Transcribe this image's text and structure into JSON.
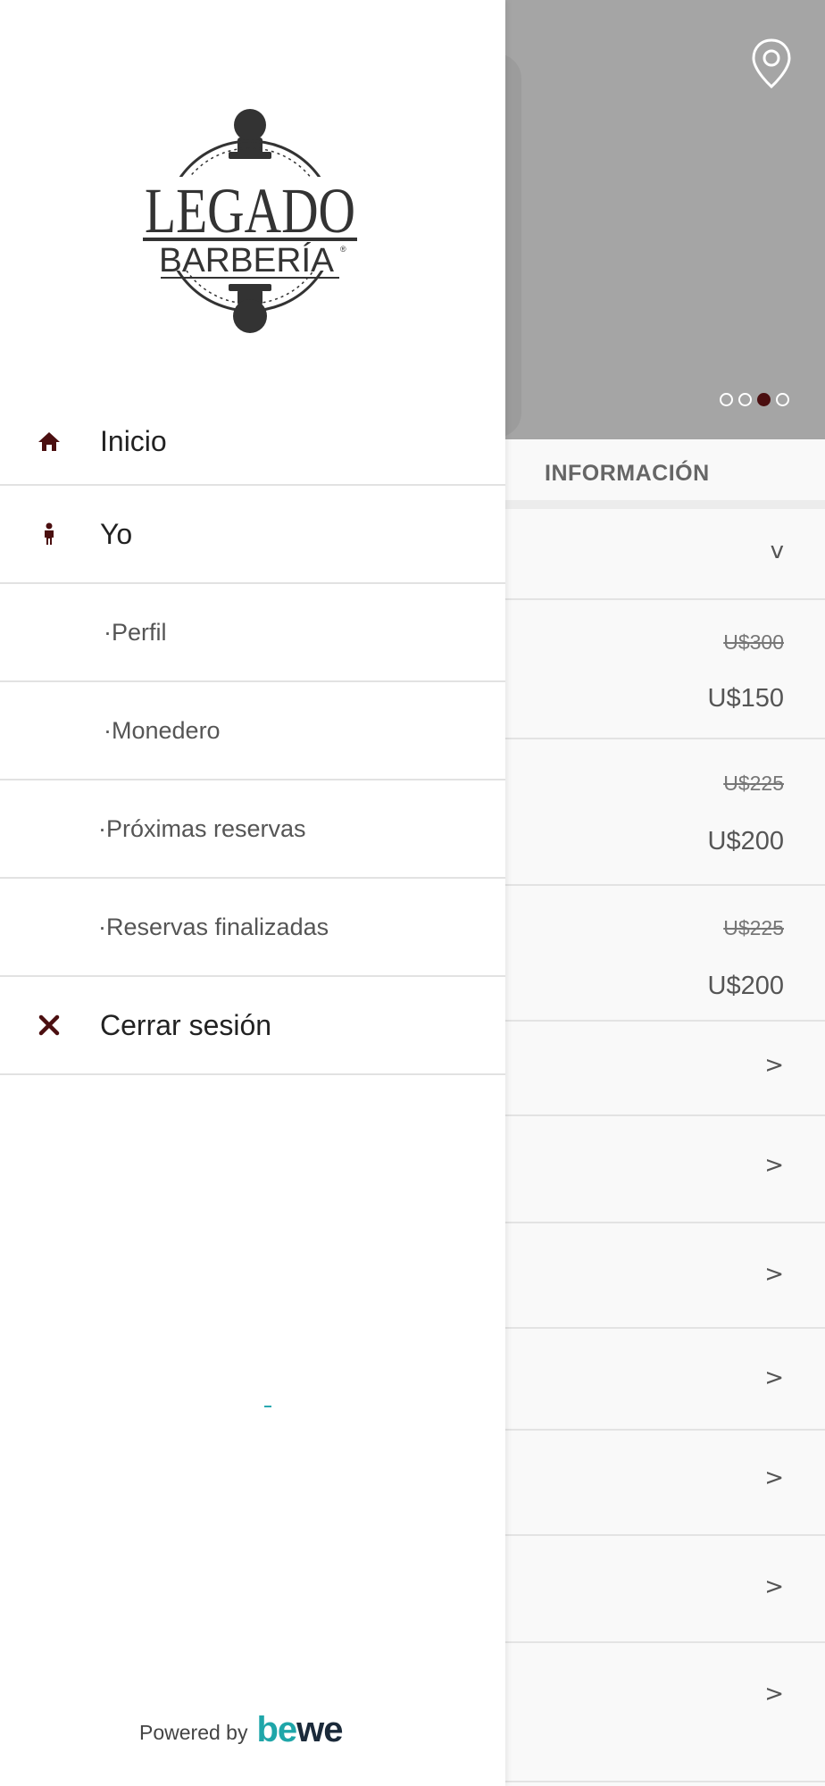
{
  "background": {
    "carousel": {
      "slides": 4,
      "active_index": 2,
      "active_color": "#4b0f10"
    },
    "info_tab": "INFORMACIÓN",
    "first_row_chevron": "v",
    "prices": [
      {
        "old": "U$300",
        "new": "U$150"
      },
      {
        "old": "U$225",
        "new": "U$200"
      },
      {
        "old": "U$225",
        "new": "U$200"
      }
    ],
    "list_chevron": ">"
  },
  "drawer": {
    "logo": {
      "word1": "LEGADO",
      "word2": "BARBERÍA",
      "mark": "®"
    },
    "menu": [
      {
        "label": "Inicio",
        "icon": "home-icon"
      },
      {
        "label": "Yo",
        "icon": "person-icon"
      }
    ],
    "submenu": [
      {
        "label": "·Perfil"
      },
      {
        "label": "·Monedero"
      },
      {
        "label": "·Próximas reservas"
      },
      {
        "label": "·Reservas finalizadas"
      }
    ],
    "logout": {
      "label": "Cerrar sesión",
      "icon": "close-icon"
    },
    "footer": {
      "powered_by": "Powered by",
      "brand_part1": "be",
      "brand_part2": "we"
    }
  },
  "colors": {
    "accent": "#4b0f10",
    "brand_teal": "#1fa6a9",
    "brand_dark": "#1b2a3a"
  }
}
